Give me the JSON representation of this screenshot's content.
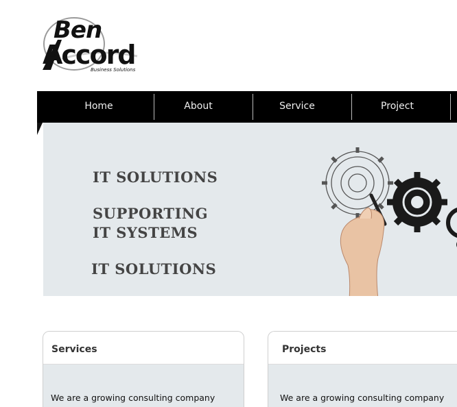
{
  "logo": {
    "word1": "Ben",
    "word2": "Accord",
    "tagline": "Business Solutions"
  },
  "nav": {
    "items": [
      {
        "label": "Home",
        "active": true
      },
      {
        "label": "About"
      },
      {
        "label": "Service"
      },
      {
        "label": "Project"
      }
    ]
  },
  "hero": {
    "lines": [
      "IT SOLUTIONS",
      "SUPPORTING",
      "IT SYSTEMS",
      "IT SOLUTIONS"
    ],
    "background": "#e4e9ec"
  },
  "cards": [
    {
      "title": "Services",
      "text": "We are a growing consulting company"
    },
    {
      "title": "Projects",
      "text": "We are a growing consulting company"
    }
  ],
  "colors": {
    "nav_bg": "#000000",
    "nav_text": "#f0f0f0",
    "hero_text": "#444444"
  }
}
